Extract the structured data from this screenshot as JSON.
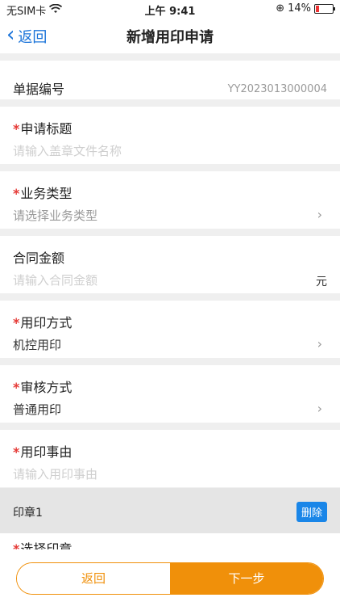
{
  "status_bar": {
    "carrier": "无SIM卡",
    "time": "上午 9:41",
    "battery": "14%",
    "battery_level": 0.14
  },
  "nav": {
    "back_label": "返回",
    "title": "新增用印申请"
  },
  "form": {
    "doc_no_label": "单据编号",
    "doc_no_value": "YY2023013000004",
    "apply_title_label": "申请标题",
    "apply_title_placeholder": "请输入盖章文件名称",
    "business_type_label": "业务类型",
    "business_type_placeholder": "请选择业务类型",
    "contract_amount_label": "合同金额",
    "contract_amount_placeholder": "请输入合同金额",
    "currency_unit": "元",
    "seal_method_label": "用印方式",
    "seal_method_value": "机控用印",
    "review_method_label": "审核方式",
    "review_method_value": "普通用印",
    "reason_label": "用印事由",
    "reason_placeholder": "请输入用印事由",
    "select_seal_label": "选择印章"
  },
  "seal_section": {
    "title": "印章1",
    "delete_label": "删除"
  },
  "bottom": {
    "back_label": "返回",
    "next_label": "下一步"
  },
  "colors": {
    "accent": "#1a73d9",
    "orange": "#f0900a",
    "required": "#e53935"
  }
}
